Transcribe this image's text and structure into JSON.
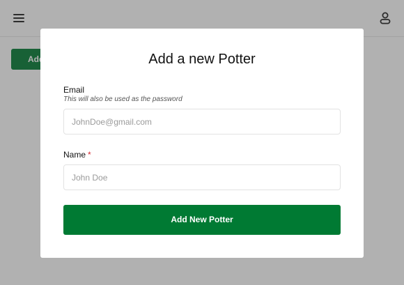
{
  "header": {
    "menu_icon": "hamburger-menu-icon",
    "user_icon": "user-icon"
  },
  "page": {
    "add_button_label": "Add"
  },
  "modal": {
    "title": "Add a new Potter",
    "email": {
      "label": "Email",
      "hint": "This will also be used as the password",
      "placeholder": "JohnDoe@gmail.com",
      "value": ""
    },
    "name": {
      "label": "Name",
      "required_marker": "*",
      "placeholder": "John Doe",
      "value": ""
    },
    "submit_label": "Add New Potter"
  },
  "colors": {
    "primary": "#007a33",
    "required": "#d6262f",
    "overlay": "rgba(60,60,60,0.4)"
  }
}
